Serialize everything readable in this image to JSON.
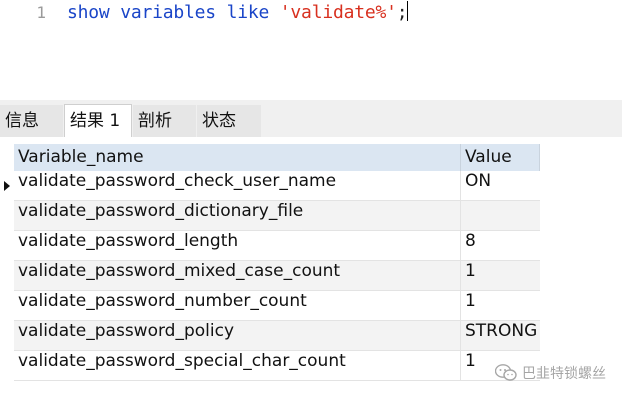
{
  "editor": {
    "line_number": "1",
    "sql": {
      "kw_show": "show",
      "kw_variables": "variables",
      "kw_like": "like",
      "pattern": "'validate%'",
      "terminator": ";"
    }
  },
  "tabs": [
    {
      "label": "信息",
      "active": false
    },
    {
      "label": "结果 1",
      "active": true
    },
    {
      "label": "剖析",
      "active": false
    },
    {
      "label": "状态",
      "active": false
    }
  ],
  "grid": {
    "columns": [
      "Variable_name",
      "Value"
    ],
    "rows": [
      [
        "validate_password_check_user_name",
        "ON"
      ],
      [
        "validate_password_dictionary_file",
        ""
      ],
      [
        "validate_password_length",
        "8"
      ],
      [
        "validate_password_mixed_case_count",
        "1"
      ],
      [
        "validate_password_number_count",
        "1"
      ],
      [
        "validate_password_policy",
        "STRONG"
      ],
      [
        "validate_password_special_char_count",
        "1"
      ]
    ],
    "current_row": 0
  },
  "watermark": {
    "text": "巴韭特锁螺丝",
    "icon": "wechat-icon"
  },
  "colors": {
    "keyword": "#1a45c8",
    "string": "#d8301f",
    "header_bg": "#dbe6f2"
  }
}
